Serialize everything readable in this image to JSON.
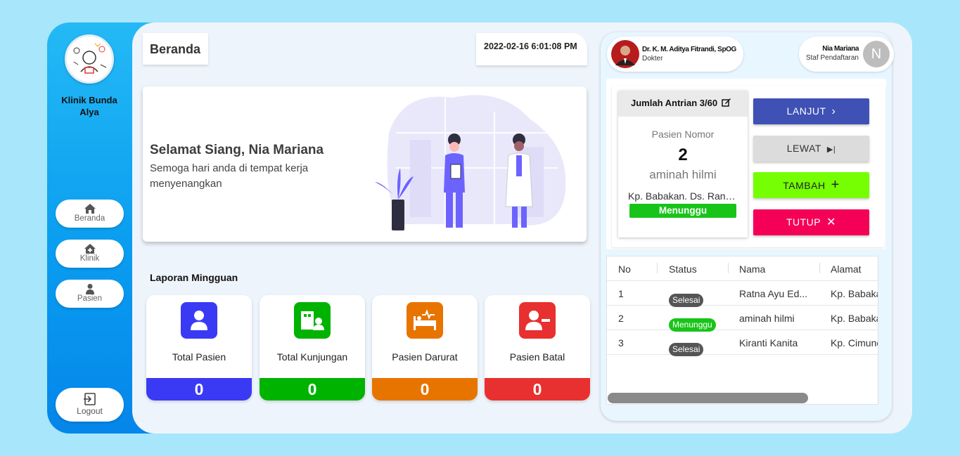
{
  "sidebar": {
    "clinic_name": "Klinik Bunda Alya",
    "nav": [
      {
        "label": "Beranda",
        "icon": "home-icon"
      },
      {
        "label": "Klinik",
        "icon": "clinic-icon"
      },
      {
        "label": "Pasien",
        "icon": "patient-icon"
      }
    ],
    "logout_label": "Logout"
  },
  "header": {
    "page_title": "Beranda",
    "datetime": "2022-02-16 6:01:08 PM"
  },
  "welcome": {
    "greeting": "Selamat Siang, Nia Mariana",
    "message": "Semoga hari anda di tempat kerja menyenangkan"
  },
  "weekly_report": {
    "title": "Laporan Mingguan",
    "stats": [
      {
        "label": "Total Pasien",
        "value": "0",
        "color": "#3a3af5",
        "icon": "patient-icon"
      },
      {
        "label": "Total Kunjungan",
        "value": "0",
        "color": "#00b300",
        "icon": "hospital-visit-icon"
      },
      {
        "label": "Pasien Darurat",
        "value": "0",
        "color": "#e87400",
        "icon": "emergency-bed-icon"
      },
      {
        "label": "Pasien Batal",
        "value": "0",
        "color": "#e83030",
        "icon": "user-remove-icon"
      }
    ]
  },
  "users": {
    "doctor": {
      "name": "Dr. K. M. Aditya Fitrandi, SpOG",
      "role": "Dokter"
    },
    "staff": {
      "name": "Nia Mariana",
      "role": "Staf Pendaftaran",
      "initial": "N"
    }
  },
  "queue": {
    "header": "Jumlah Antrian 3/60",
    "patient_label": "Pasien Nomor",
    "number": "2",
    "name": "aminah hilmi",
    "address": "Kp. Babakan. Ds. Rancamanyar",
    "status": "Menunggu",
    "actions": [
      {
        "label": "LANJUT",
        "symbol": "›",
        "bg": "#3f51b5",
        "fg": "#ffffff"
      },
      {
        "label": "LEWAT",
        "symbol": "▶|",
        "bg": "#dcdcdc",
        "fg": "#333333"
      },
      {
        "label": "TAMBAH",
        "symbol": "+",
        "bg": "#76ff03",
        "fg": "#222222"
      },
      {
        "label": "TUTUP",
        "symbol": "✕",
        "bg": "#f50057",
        "fg": "#ffffff"
      }
    ]
  },
  "table": {
    "columns": [
      "No",
      "Status",
      "Nama",
      "Alamat"
    ],
    "rows": [
      {
        "no": "1",
        "status": "Selesai",
        "name": "Ratna Ayu Ed...",
        "address": "Kp. Babakan"
      },
      {
        "no": "2",
        "status": "Menunggu",
        "name": "aminah hilmi",
        "address": "Kp. Babakan"
      },
      {
        "no": "3",
        "status": "Selesai",
        "name": "Kiranti Kanita",
        "address": "Kp. Cimuncang"
      }
    ],
    "status_colors": {
      "Selesai": "#555555",
      "Menunggu": "#19c419"
    }
  }
}
